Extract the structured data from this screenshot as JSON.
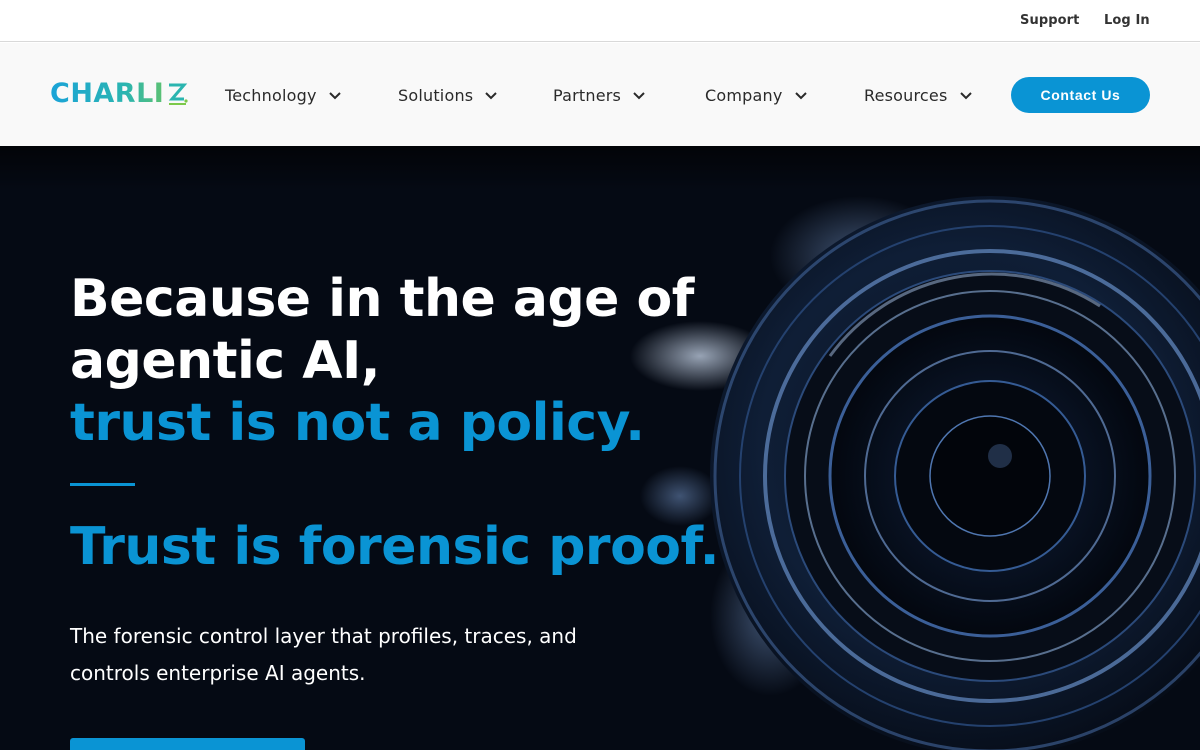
{
  "utility_bar": {
    "support_label": "Support",
    "login_label": "Log In"
  },
  "nav": {
    "logo_text": "CHARLI",
    "items": [
      {
        "label": "Technology",
        "icon": "chevron-down-icon"
      },
      {
        "label": "Solutions",
        "icon": "chevron-down-icon"
      },
      {
        "label": "Partners",
        "icon": "chevron-down-icon"
      },
      {
        "label": "Company",
        "icon": "chevron-down-icon"
      },
      {
        "label": "Resources",
        "icon": "chevron-down-icon"
      }
    ],
    "contact_label": "Contact Us"
  },
  "hero": {
    "headline_line1": "Because in the age of",
    "headline_line2": "agentic AI,",
    "headline_accent": "trust is not a policy.",
    "subheadline": "Trust is forensic proof.",
    "description": "The forensic control layer that profiles, traces, and controls enterprise AI agents."
  },
  "colors": {
    "accent": "#0a94d4",
    "hero_background": "#050a14",
    "logo_gradient_start": "#1aa3d8",
    "logo_gradient_end": "#7cc94a"
  }
}
